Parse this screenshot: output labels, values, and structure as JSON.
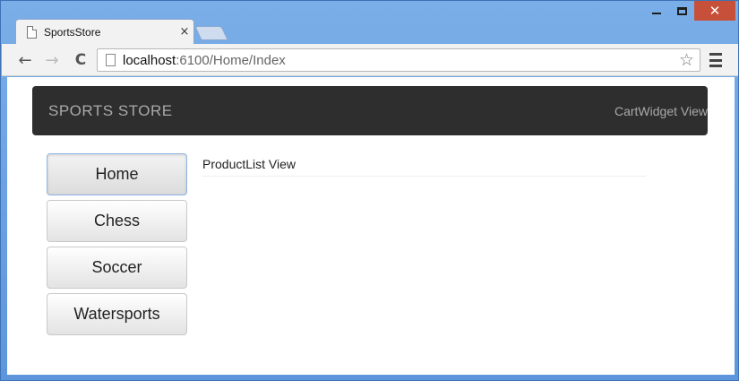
{
  "window": {
    "minimize_icon": "minimize-icon",
    "maximize_icon": "maximize-icon",
    "close_label": "✕"
  },
  "tabs": [
    {
      "title": "SportsStore",
      "close_label": "×",
      "icon": "page-icon"
    }
  ],
  "toolbar": {
    "back_label": "←",
    "forward_label": "→",
    "reload_label": "C",
    "address": {
      "host": "localhost",
      "path": ":6100/Home/Index"
    },
    "bookmark_label": "☆"
  },
  "page": {
    "brand": "SPORTS STORE",
    "cart_widget": "CartWidget View",
    "categories": [
      {
        "label": "Home",
        "active": true
      },
      {
        "label": "Chess",
        "active": false
      },
      {
        "label": "Soccer",
        "active": false
      },
      {
        "label": "Watersports",
        "active": false
      }
    ],
    "content_text": "ProductList View"
  },
  "colors": {
    "frame": "#6fa3e0",
    "navbar": "#2e2e2e",
    "close_button": "#c7503a"
  }
}
